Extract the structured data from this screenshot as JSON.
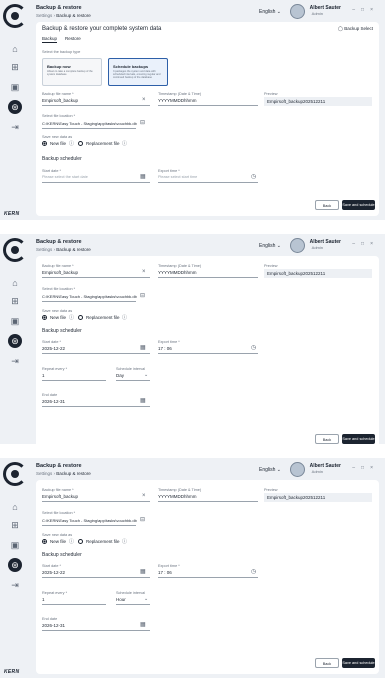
{
  "sidebar": {
    "brand": "KERN",
    "items": [
      {
        "icon": "home-icon",
        "glyph": "⌂"
      },
      {
        "icon": "grid-icon",
        "glyph": "⊞"
      },
      {
        "icon": "calendar-icon",
        "glyph": "▣"
      },
      {
        "icon": "backup-icon",
        "glyph": "⊛"
      },
      {
        "icon": "logout-icon",
        "glyph": "⇥"
      }
    ]
  },
  "header": {
    "title": "Backup & restore",
    "breadcrumb_root": "Settings",
    "breadcrumb_current": "Backup & restore",
    "language": "English",
    "user_name": "Albert Sauter",
    "user_role": "Admin"
  },
  "shot1": {
    "heading": "Backup & restore your complete system data",
    "tabs": [
      "Backup",
      "Restore"
    ],
    "backup_select": "Backup Select",
    "select_type_label": "Select the backup type",
    "options": [
      {
        "title": "Backup now",
        "desc": "Allows to take a complete backup of the system database"
      },
      {
        "title": "Schedule backups",
        "desc": "It packages the system and data with scheduled intervals, ensuring regular and continued backup of the database"
      }
    ]
  },
  "form": {
    "backup_file_name_label": "Backup file name *",
    "backup_file_name": "Empirsoft_backup",
    "timestamp_label": "Timestamp (Date & Time)",
    "timestamp": "YYYYMMDDhhmm",
    "preview_label": "Preview",
    "preview": "Empirsoft_backup202512211",
    "location_label": "Select file location *",
    "location": "C:\\KERN\\Easy Touch - Staging\\app\\tasks\\vouchbk.db",
    "save_new_label": "Save new data as",
    "new_file": "New file",
    "replacement_file": "Replacement file",
    "schedule_heading": "Backup scheduler",
    "start_date_label": "Start date *",
    "start_date_placeholder": "Please select the start date",
    "start_time_label": "Export time *",
    "start_time_placeholder": "Please select start time",
    "back": "Back",
    "save_schedule": "Save and schedule"
  },
  "shot2": {
    "start_date": "2025-12-22",
    "export_time": "17 : 06",
    "repeat_every_label": "Repeat every *",
    "repeat_every": "1",
    "schedule_interval_label": "Schedule interval",
    "schedule_interval_value": "Day",
    "end_date_label": "End date",
    "end_date": "2026-12-31"
  },
  "shot3": {
    "schedule_interval_value": "Hour"
  }
}
